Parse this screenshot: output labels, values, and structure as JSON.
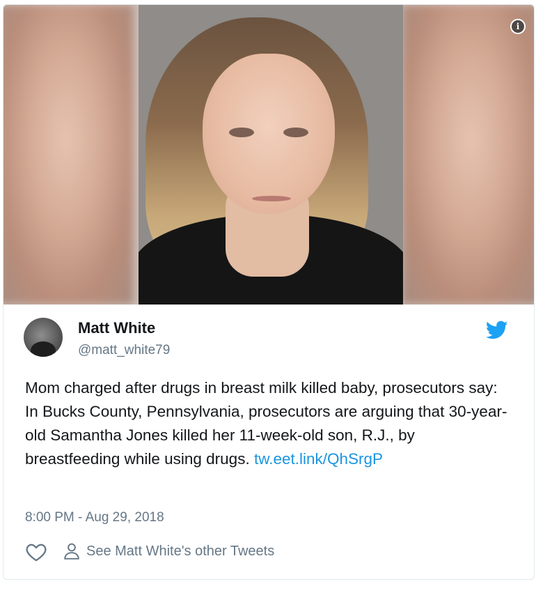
{
  "media": {
    "icons": {
      "info": "info-icon"
    }
  },
  "tweet": {
    "author_name": "Matt White",
    "author_handle": "@matt_white79",
    "text_main": "Mom charged after drugs in breast milk killed baby, prosecutors say: In Bucks County, Pennsylvania, prosecutors are arguing that 30-year-old Samantha Jones killed her 11-week-old son, R.J., by breastfeeding while using drugs.",
    "link_text": "tw.eet.link/QhSrgP",
    "timestamp": "8:00 PM - Aug 29, 2018",
    "profile_link": "See Matt White's other Tweets",
    "icons": {
      "brand": "twitter-bird-icon",
      "like": "heart-icon",
      "profile": "person-icon"
    }
  },
  "colors": {
    "brand_blue": "#1da1f2",
    "link_blue": "#1b95e0",
    "text_primary": "#14171a",
    "text_secondary": "#657786",
    "border": "#e1e8ed"
  }
}
